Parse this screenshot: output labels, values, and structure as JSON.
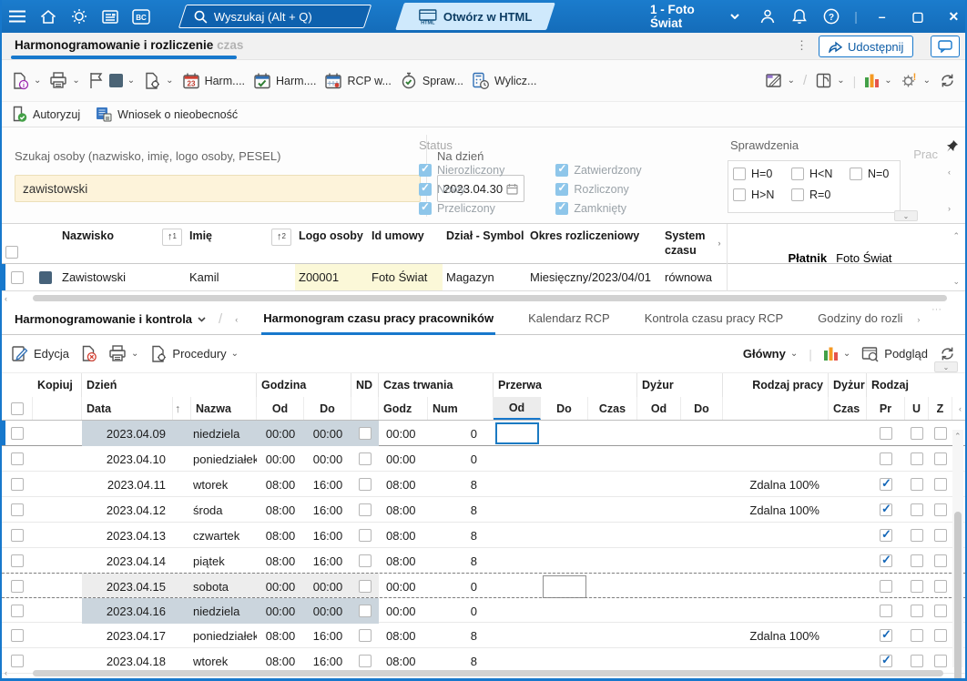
{
  "colors": {
    "accent": "#1778cc",
    "topbar": "#1874c8",
    "check_blue": "#1467b8",
    "sunday_highlight": "#cbd5dd",
    "saturday_highlight": "#ededed",
    "yellow_cell": "#fbf8d8",
    "search_input_cream": "#fdf3da",
    "status_checkbox": "#8ec6ea"
  },
  "topbar": {
    "icons": [
      "menu-icon",
      "home-icon",
      "ideas-icon",
      "news-icon",
      "bc-icon",
      "search-icon",
      "html-window-icon",
      "user-icon",
      "notifications-icon",
      "help-icon",
      "minimize-icon",
      "maximize-icon",
      "close-icon"
    ],
    "search_placeholder": "Wyszukaj (Alt + Q)",
    "html_button": "Otwórz w HTML",
    "company": "1 - Foto Świat",
    "minimize": "–",
    "maximize": "▢",
    "close": "✕"
  },
  "titlebar": {
    "title": "Harmonogramowanie i rozliczenie",
    "title_truncated": " czas",
    "share_label": "Udostępnij"
  },
  "ribbon": {
    "buttons": [
      {
        "label": "Harm....",
        "icon": "cal23"
      },
      {
        "label": "Harm....",
        "icon": "calcheck"
      },
      {
        "label": "RCP w...",
        "icon": "calrcp"
      },
      {
        "label": "Spraw...",
        "icon": "stopwatch"
      },
      {
        "label": "Wylicz...",
        "icon": "calcclock"
      }
    ],
    "secondary": [
      {
        "label": "Autoryzuj",
        "icon": "doccheck"
      },
      {
        "label": "Wniosek o nieobecność",
        "icon": "absence"
      }
    ]
  },
  "filters": {
    "search_label": "Szukaj osoby (nazwisko, imię, logo osoby, PESEL)",
    "search_value": "zawistowski",
    "date_label": "Na dzień",
    "date_value": "2023.04.30",
    "status": {
      "legend": "Status",
      "options": [
        {
          "label": "Nierozliczony",
          "checked": true
        },
        {
          "label": "Nowy",
          "checked": true
        },
        {
          "label": "Przeliczony",
          "checked": true
        },
        {
          "label": "Zatwierdzony",
          "checked": true
        },
        {
          "label": "Rozliczony",
          "checked": true
        },
        {
          "label": "Zamknięty",
          "checked": true
        }
      ]
    },
    "sprawdzenia": {
      "legend": "Sprawdzenia",
      "options": [
        {
          "label": "H=0",
          "checked": false
        },
        {
          "label": "H<N",
          "checked": false
        },
        {
          "label": "N=0",
          "checked": false
        },
        {
          "label": "H>N",
          "checked": false
        },
        {
          "label": "R=0",
          "checked": false
        }
      ]
    },
    "prac_label": "Prac"
  },
  "employees": {
    "columns": [
      "Nazwisko",
      "Imię",
      "Logo osoby",
      "Id umowy",
      "Dział - Symbol",
      "Okres rozliczeniowy",
      "System czasu"
    ],
    "sort_primary": "1",
    "sort_secondary": "2",
    "row": {
      "nazwisko": "Zawistowski",
      "imie": "Kamil",
      "logo": "Z00001",
      "id_umowy": "Foto Świat",
      "dzial": "Magazyn",
      "okres": "Miesięczny/2023/04/01",
      "system": "równoważny"
    },
    "platnik_label": "Płatnik",
    "platnik_value": "Foto Świat"
  },
  "nav": {
    "breadcrumb": "Harmonogramowanie i kontrola",
    "tabs": [
      {
        "label": "Harmonogram czasu pracy pracowników",
        "active": true
      },
      {
        "label": "Kalendarz RCP",
        "active": false
      },
      {
        "label": "Kontrola czasu pracy RCP",
        "active": false
      },
      {
        "label": "Godziny do rozli",
        "active": false
      }
    ]
  },
  "gridbar": {
    "edit": "Edycja",
    "procedures": "Procedury",
    "view": "Główny",
    "preview": "Podgląd"
  },
  "grid": {
    "groups": [
      "Kopiuj",
      "Dzień",
      "Godzina",
      "ND",
      "Czas trwania",
      "Przerwa",
      "Dyżur",
      "Rodzaj pracy",
      "Dyżur",
      "Rodzaj"
    ],
    "subheaders": {
      "data": "Data",
      "nazwa": "Nazwa",
      "od": "Od",
      "do": "Do",
      "godz": "Godz",
      "num": "Num",
      "przerwa_od": "Od",
      "przerwa_do": "Do",
      "przerwa_czas": "Czas",
      "dyzur_od": "Od",
      "dyzur_do": "Do",
      "dyzur_czas": "Czas",
      "pr": "Pr",
      "u": "U",
      "z": "Z"
    },
    "rows": [
      {
        "data": "2023.04.09",
        "nazwa": "niedziela",
        "od": "00:00",
        "do": "00:00",
        "godz": "00:00",
        "num": "0",
        "rodzaj_pracy": "",
        "pr": false,
        "highlight": "sunday",
        "current": true,
        "focus_cell": "przerwa_od"
      },
      {
        "data": "2023.04.10",
        "nazwa": "poniedziałek",
        "od": "00:00",
        "do": "00:00",
        "godz": "00:00",
        "num": "0",
        "rodzaj_pracy": "",
        "pr": false
      },
      {
        "data": "2023.04.11",
        "nazwa": "wtorek",
        "od": "08:00",
        "do": "16:00",
        "godz": "08:00",
        "num": "8",
        "rodzaj_pracy": "Zdalna 100%",
        "pr": true
      },
      {
        "data": "2023.04.12",
        "nazwa": "środa",
        "od": "08:00",
        "do": "16:00",
        "godz": "08:00",
        "num": "8",
        "rodzaj_pracy": "Zdalna 100%",
        "pr": true
      },
      {
        "data": "2023.04.13",
        "nazwa": "czwartek",
        "od": "08:00",
        "do": "16:00",
        "godz": "08:00",
        "num": "8",
        "rodzaj_pracy": "",
        "pr": true
      },
      {
        "data": "2023.04.14",
        "nazwa": "piątek",
        "od": "08:00",
        "do": "16:00",
        "godz": "08:00",
        "num": "8",
        "rodzaj_pracy": "",
        "pr": true
      },
      {
        "data": "2023.04.15",
        "nazwa": "sobota",
        "od": "00:00",
        "do": "00:00",
        "godz": "00:00",
        "num": "0",
        "rodzaj_pracy": "",
        "pr": false,
        "highlight": "saturday",
        "dashed_top": true,
        "outline_cell": "przerwa_do"
      },
      {
        "data": "2023.04.16",
        "nazwa": "niedziela",
        "od": "00:00",
        "do": "00:00",
        "godz": "00:00",
        "num": "0",
        "rodzaj_pracy": "",
        "pr": false,
        "highlight": "sunday",
        "dashed_top": true
      },
      {
        "data": "2023.04.17",
        "nazwa": "poniedziałek",
        "od": "08:00",
        "do": "16:00",
        "godz": "08:00",
        "num": "8",
        "rodzaj_pracy": "Zdalna 100%",
        "pr": true
      },
      {
        "data": "2023.04.18",
        "nazwa": "wtorek",
        "od": "08:00",
        "do": "16:00",
        "godz": "08:00",
        "num": "8",
        "rodzaj_pracy": "",
        "pr": true
      }
    ]
  }
}
